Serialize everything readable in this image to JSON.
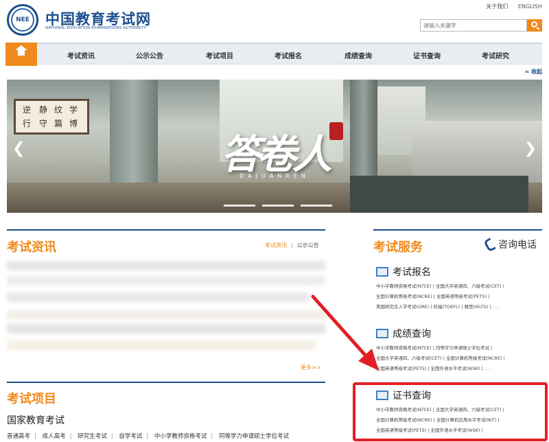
{
  "toplinks": {
    "about": "关于我们",
    "english": "ENGLISH"
  },
  "header": {
    "logo_text": "NEE",
    "site_name": "中国教育考试网",
    "site_name_en": "NATIONAL EDUCATION EXAMINATIONS AUTHORITY"
  },
  "search": {
    "placeholder": "请输入关键字"
  },
  "nav": {
    "items": [
      "考试资讯",
      "公示公告",
      "考试项目",
      "考试报名",
      "成绩查询",
      "证书查询",
      "考试研究"
    ]
  },
  "collapse": "≈ 收起",
  "banner": {
    "title": "答卷人",
    "subtitle": "DAJUANREN",
    "board": [
      "逆",
      "行",
      "静",
      "守",
      "纹",
      "篇",
      "学",
      "博"
    ]
  },
  "news": {
    "title": "考试资讯",
    "tab_active": "考试资讯",
    "tab_other": "公示公告",
    "more": "更多>>"
  },
  "projects": {
    "title": "考试项目",
    "subtitle": "国家教育考试",
    "links": [
      "普通高考",
      "成人高考",
      "研究生考试",
      "自学考试",
      "中小学教师资格考试",
      "同等学力申请硕士学位考试"
    ]
  },
  "services": {
    "title": "考试服务",
    "phone": "咨询电话",
    "blocks": [
      {
        "title": "考试报名",
        "lines": [
          "中小学教师资格考试(NTCE)  |  全国大学英语四、六级考试(CET)  |",
          "全国计算机等级考试(NCRE)  |  全国英语等级考试(PETS)  |",
          "美国研究生入学考试(GRE)  |  托福(TOEFL)  |  雅思(IELTS)  |  . . ."
        ]
      },
      {
        "title": "成绩查询",
        "lines": [
          "中小学教师资格考试(NTCE)  |  同等学力申请硕士学位考试  |",
          "全国大学英语四、六级考试(CET)  |  全国计算机等级考试(NCRE)  |",
          "全国英语等级考试(PETS)  |  全国外语水平考试(WSK)  |  . . ."
        ]
      },
      {
        "title": "证书查询",
        "lines": [
          "中小学教师资格考试(NTCE)  |  全国大学英语四、六级考试(CET)  |",
          "全国计算机等级考试(NCRE)  |  全国计算机应用水平考试(NIT)  |",
          "全国英语等级考试(PETS)  |  全国外语水平考试(WSK)  |"
        ]
      }
    ]
  },
  "colors": {
    "accent": "#f08a1c",
    "brand": "#1a4f8f",
    "highlight": "#e21f26"
  }
}
